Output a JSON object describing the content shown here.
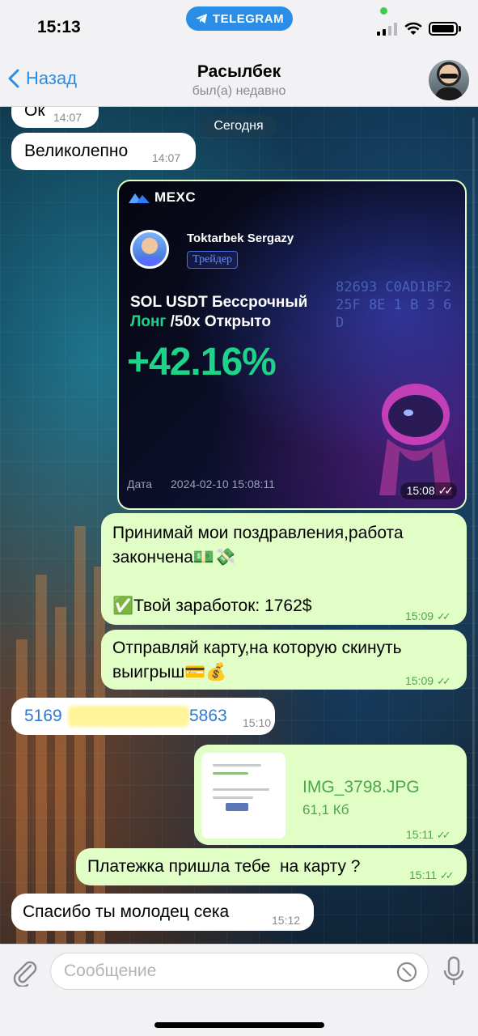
{
  "status_bar": {
    "time": "15:13",
    "app_pill": "TELEGRAM"
  },
  "header": {
    "back_label": "Назад",
    "contact_name": "Расылбек",
    "contact_status": "был(а) недавно"
  },
  "chat": {
    "date_separator": "Сегодня",
    "messages": [
      {
        "id": "m1",
        "direction": "in",
        "text": "Ок",
        "time": "14:07"
      },
      {
        "id": "m2",
        "direction": "in",
        "text": "Великолепно",
        "time": "14:07"
      },
      {
        "id": "m3",
        "direction": "out",
        "type": "image",
        "time": "15:08"
      },
      {
        "id": "m4",
        "direction": "out",
        "line1": "Принимай мои поздравления,работа",
        "line2": "закончена💵💸",
        "line3": "✅Твой заработок: 1762$",
        "time": "15:09"
      },
      {
        "id": "m5",
        "direction": "out",
        "line1": "Отправляй карту,на которую скинуть",
        "line2": "выигрыш💳💰",
        "time": "15:09"
      },
      {
        "id": "m6",
        "direction": "in",
        "card_start": "5169",
        "card_end": "5863",
        "time": "15:10"
      },
      {
        "id": "m7",
        "direction": "out",
        "type": "file",
        "file_name": "IMG_3798.JPG",
        "file_size": "61,1 Кб",
        "time": "15:11"
      },
      {
        "id": "m8",
        "direction": "out",
        "text": "Платежка пришла тебе  на карту ?",
        "time": "15:11"
      },
      {
        "id": "m9",
        "direction": "in",
        "text": "Спасибо ты молодец сека",
        "time": "15:12"
      }
    ]
  },
  "mexc_card": {
    "brand": "MEXC",
    "trader_name": "Toktarbek Sergazy",
    "trader_tag": "Трейдер",
    "pair_line1": "SOL USDT Бессрочный",
    "pair_long": "Лонг",
    "pair_rest": " /50x Открыто",
    "pnl": "+42.16%",
    "date_label": "Дата",
    "date_value": "2024-02-10 15:08:11",
    "codes": "82693 C0AD1BF2 25F 8E 1 B 3 6 D"
  },
  "input": {
    "placeholder": "Сообщение"
  },
  "colors": {
    "accent": "#2a8de6",
    "outgoing_bubble": "#e1fec6",
    "incoming_bubble": "#ffffff",
    "pnl_green": "#1ed28a"
  }
}
